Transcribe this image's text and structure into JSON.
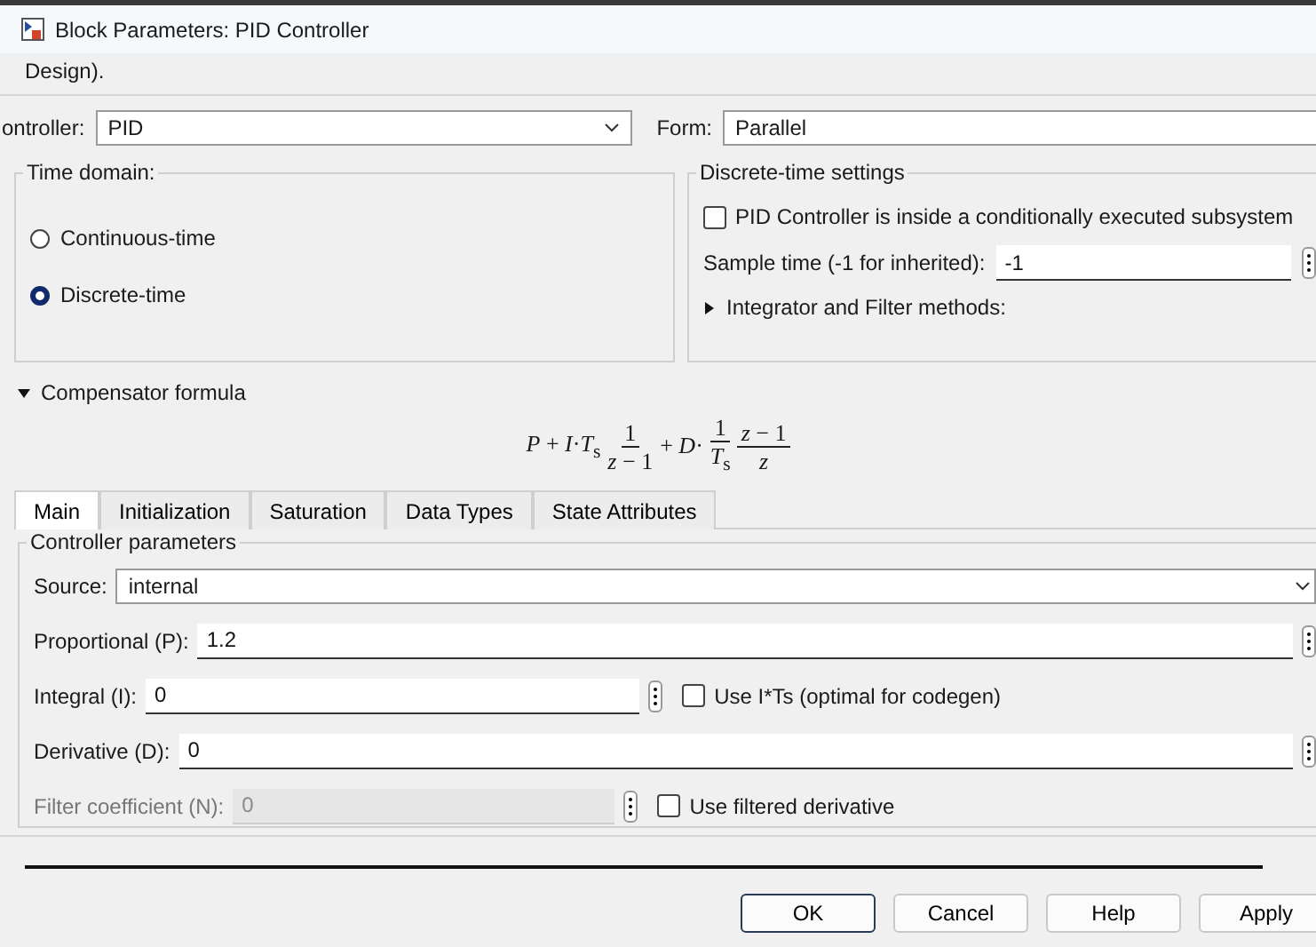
{
  "window": {
    "title": "Block Parameters: PID Controller"
  },
  "description": "Design).",
  "controller": {
    "label": "ontroller:",
    "value": "PID"
  },
  "form": {
    "label": "Form:",
    "value": "Parallel"
  },
  "time_domain": {
    "title": "Time domain:",
    "options": [
      {
        "label": "Continuous-time",
        "selected": false
      },
      {
        "label": "Discrete-time",
        "selected": true
      }
    ]
  },
  "discrete_settings": {
    "title": "Discrete-time settings",
    "checkbox": {
      "label": "PID Controller is inside a conditionally executed subsystem",
      "checked": false
    },
    "sample_time": {
      "label": "Sample time (-1 for inherited):",
      "value": "-1"
    },
    "methods": {
      "label": "Integrator and Filter methods:",
      "expanded": false
    }
  },
  "compensator": {
    "label": "Compensator formula",
    "expanded": true,
    "formula": {
      "lead": "*P* + *I*·*T*$_{s}$",
      "frac1": {
        "num": "1",
        "den": "*z* − 1"
      },
      "mid": "+ *D*·",
      "frac2": {
        "num": "1",
        "den": "*T*$_{s}$"
      },
      "frac3": {
        "num": "*z* − 1",
        "den": "*z*"
      }
    }
  },
  "tabs": [
    {
      "label": "Main",
      "selected": true
    },
    {
      "label": "Initialization",
      "selected": false
    },
    {
      "label": "Saturation",
      "selected": false
    },
    {
      "label": "Data Types",
      "selected": false
    },
    {
      "label": "State Attributes",
      "selected": false
    }
  ],
  "parameters": {
    "title": "Controller parameters",
    "source": {
      "label": "Source:",
      "value": "internal"
    },
    "rows": [
      {
        "label": "Proportional (P):",
        "value": "1.2",
        "disabled": false
      },
      {
        "label": "Integral (I):",
        "value": "0",
        "disabled": false,
        "checkbox": {
          "label": "Use I*Ts (optimal for codegen)",
          "checked": false
        }
      },
      {
        "label": "Derivative (D):",
        "value": "0",
        "disabled": false
      },
      {
        "label": "Filter coefficient (N):",
        "value": "0",
        "disabled": true,
        "checkbox": {
          "label": "Use filtered derivative",
          "checked": false
        }
      }
    ]
  },
  "buttons": [
    {
      "label": "OK",
      "focused": true
    },
    {
      "label": "Cancel",
      "focused": false
    },
    {
      "label": "Help",
      "focused": false
    },
    {
      "label": "Apply",
      "focused": false
    }
  ]
}
